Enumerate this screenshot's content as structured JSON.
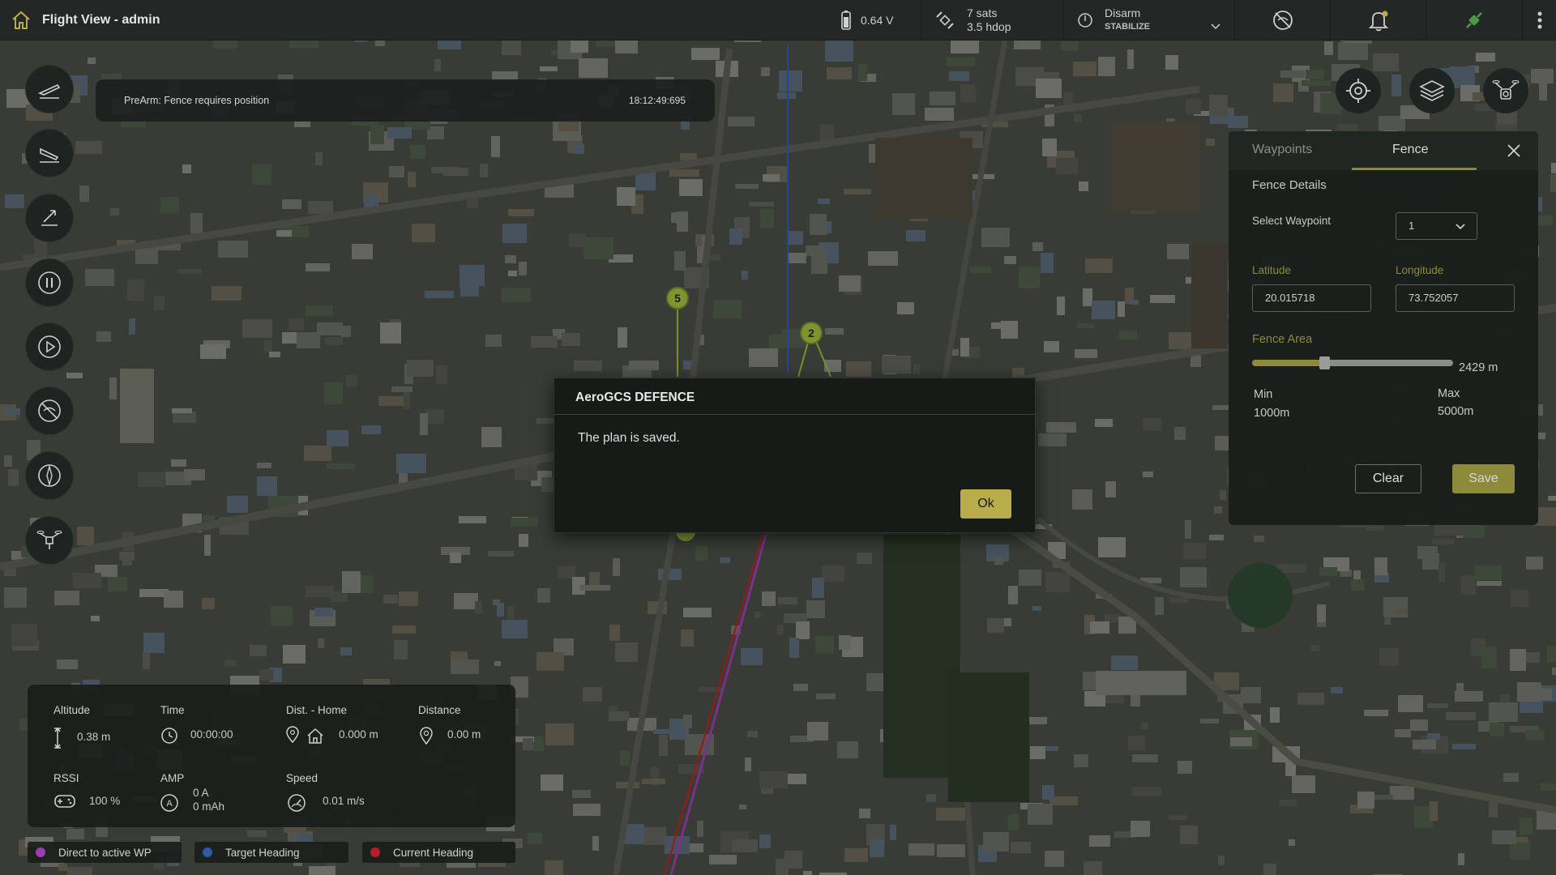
{
  "app": {
    "title": "Flight View - admin"
  },
  "status_bar": {
    "battery": "0.64 V",
    "gps_sats": "7 sats",
    "gps_hdop": "3.5 hdop",
    "arm_state": "Disarm",
    "flight_mode": "STABILIZE"
  },
  "message": {
    "text": "PreArm: Fence requires position",
    "time": "18:12:49:695"
  },
  "left_toolbar": [
    "takeoff-icon",
    "land-icon",
    "return-icon",
    "pause-icon",
    "play-icon",
    "no-gps-icon",
    "compass-icon",
    "drone-icon"
  ],
  "map_tools": [
    "target-icon",
    "layers-icon",
    "drone-camera-icon"
  ],
  "waypoint_markers": [
    "5",
    "2"
  ],
  "fence_panel": {
    "tabs": [
      "Waypoints",
      "Fence"
    ],
    "active_tab": "Fence",
    "section_title": "Fence Details",
    "select_waypoint_label": "Select Waypoint",
    "select_waypoint_value": "1",
    "latitude_label": "Latitude",
    "latitude_value": "20.015718",
    "longitude_label": "Longitude",
    "longitude_value": "73.752057",
    "fence_area_label": "Fence Area",
    "fence_area_value": "2429 m",
    "fence_area_level": 0.357,
    "min_label": "Min",
    "min_value": "1000m",
    "max_label": "Max",
    "max_value": "5000m",
    "clear_label": "Clear",
    "save_label": "Save"
  },
  "dialog": {
    "title": "AeroGCS DEFENCE",
    "message": "The plan is saved.",
    "ok_label": "Ok"
  },
  "telemetry": {
    "altitude_label": "Altitude",
    "altitude_value": "0.38 m",
    "time_label": "Time",
    "time_value": "00:00:00",
    "dist_home_label": "Dist. - Home",
    "dist_home_value": "0.000 m",
    "distance_label": "Distance",
    "distance_value": "0.00 m",
    "rssi_label": "RSSI",
    "rssi_value": "100 %",
    "amp_label": "AMP",
    "amp_value_a": "0 A",
    "amp_value_mah": "0 mAh",
    "speed_label": "Speed",
    "speed_value": "0.01 m/s"
  },
  "legend": [
    {
      "label": "Direct to active WP",
      "color": "#9b3fb0"
    },
    {
      "label": "Target Heading",
      "color": "#2f59a8"
    },
    {
      "label": "Current Heading",
      "color": "#b51f24"
    }
  ],
  "colors": {
    "accent": "#b8ad4a",
    "panel": "#191e1b",
    "waypoint": "#9cb63a"
  }
}
